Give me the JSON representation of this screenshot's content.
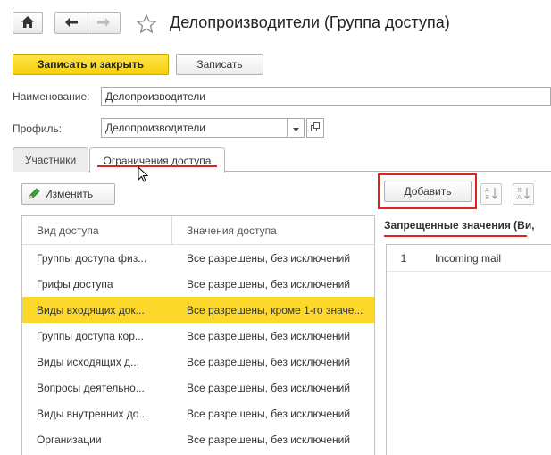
{
  "header": {
    "title": "Делопроизводители (Группа доступа)"
  },
  "commands": {
    "save_close_label": "Записать и закрыть",
    "save_label": "Записать"
  },
  "form": {
    "name_label": "Наименование:",
    "name_value": "Делопроизводители",
    "profile_label": "Профиль:",
    "profile_value": "Делопроизводители"
  },
  "tabs": [
    {
      "label": "Участники"
    },
    {
      "label": "Ограничения доступа"
    }
  ],
  "left_panel": {
    "edit_label": "Изменить",
    "columns": [
      "Вид доступа",
      "Значения доступа"
    ],
    "rows": [
      {
        "kind": "Группы доступа физ...",
        "value": "Все разрешены, без исключений"
      },
      {
        "kind": "Грифы доступа",
        "value": "Все разрешены, без исключений"
      },
      {
        "kind": "Виды входящих док...",
        "value": "Все разрешены, кроме 1-го значе..."
      },
      {
        "kind": "Группы доступа кор...",
        "value": "Все разрешены, без исключений"
      },
      {
        "kind": "Виды исходящих д...",
        "value": "Все разрешены, без исключений"
      },
      {
        "kind": "Вопросы деятельно...",
        "value": "Все разрешены, без исключений"
      },
      {
        "kind": "Виды внутренних до...",
        "value": "Все разрешены, без исключений"
      },
      {
        "kind": "Организации",
        "value": "Все разрешены, без исключений"
      }
    ]
  },
  "right_panel": {
    "add_label": "Добавить",
    "title": "Запрещенные значения (Ви,",
    "rows": [
      {
        "num": "1",
        "value": "Incoming mail"
      }
    ]
  },
  "colors": {
    "accent_yellow": "#f7cf0e",
    "selected_row": "#fcd82a",
    "annotation_red": "#e2231a"
  }
}
